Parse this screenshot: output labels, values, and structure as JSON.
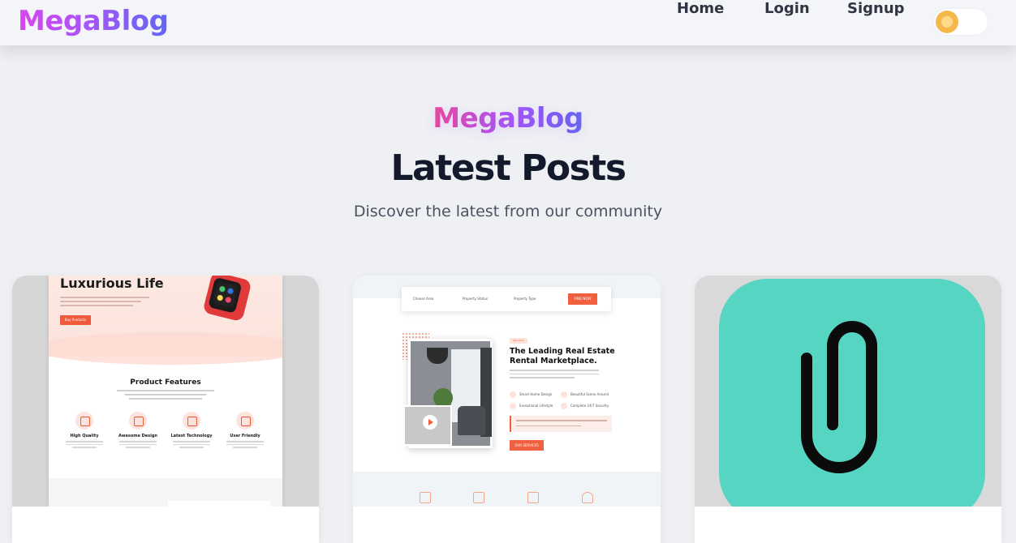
{
  "navbar": {
    "brand": "MegaBlog",
    "links": [
      {
        "label": "Home"
      },
      {
        "label": "Login"
      },
      {
        "label": "Signup"
      }
    ],
    "theme_toggle": {
      "icon": "sun-icon",
      "state": "light"
    }
  },
  "hero": {
    "brand": "MegaBlog",
    "title": "Latest Posts",
    "subtitle": "Discover the latest from our community"
  },
  "posts": [
    {
      "thumbnail": {
        "title": "Luxurious Life",
        "button": "Buy Products",
        "section_title": "Product Features",
        "features": [
          "High Quality",
          "Awesome Design",
          "Latest Technology",
          "User Friendly"
        ]
      }
    },
    {
      "thumbnail": {
        "search_fields": [
          "Choose Area",
          "Property Status",
          "Property Type"
        ],
        "search_button": "FIND NOW",
        "tag": "About Us",
        "heading": "The Leading Real Estate Rental Marketplace.",
        "features": [
          "Smart Home Design",
          "Beautiful Scene Around",
          "Exceptional Lifestyle",
          "Complete 24/7 Security"
        ],
        "cta": "OUR SERVICES"
      }
    },
    {
      "thumbnail": {
        "icon": "paperclip-icon",
        "background": "#56d6c2"
      }
    }
  ],
  "colors": {
    "brand_gradient_start": "#d946ef",
    "brand_gradient_end": "#6366f1",
    "page_bg": "#eef0f4",
    "accent_orange": "#f0603f"
  }
}
